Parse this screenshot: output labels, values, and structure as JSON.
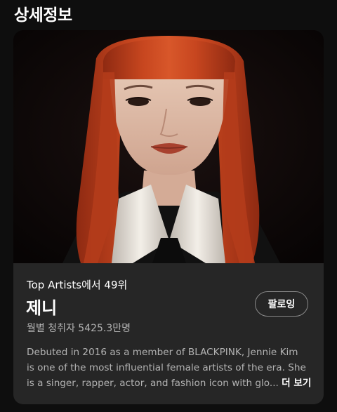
{
  "section": {
    "title": "상세정보"
  },
  "artist": {
    "rank_text": "Top Artists에서 49위",
    "name": "제니",
    "monthly_listeners": "월별 청취자 5425.3만명",
    "follow_label": "팔로잉",
    "bio_lines": [
      "Debuted in 2016 as a member of BLACKPINK, Jennie Kim",
      "is one of the most influential female artists of the era. She",
      "is a singer, rapper, actor, and fashion icon with glo..."
    ],
    "more_label": "더 보기"
  },
  "colors": {
    "background": "#0e0e0e",
    "card": "#262626",
    "secondary_text": "#b3b3b3",
    "hair": "#c2401f"
  }
}
